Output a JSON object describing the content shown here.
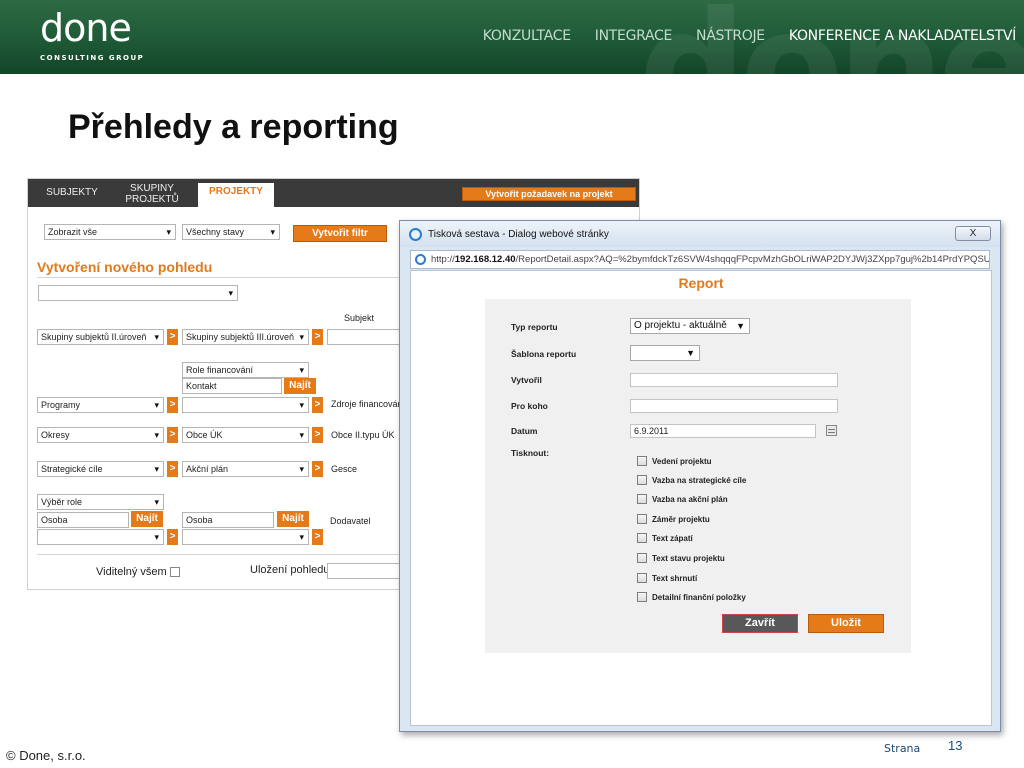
{
  "header": {
    "logo": "done",
    "logo_sub": "CONSULTING GROUP",
    "nav": [
      "KONZULTACE",
      "INTEGRACE",
      "NÁSTROJE",
      "KONFERENCE A NAKLADATELSTVÍ"
    ]
  },
  "slide_title": "Přehledy a reporting",
  "app": {
    "tabs": [
      "SUBJEKTY",
      "SKUPINY PROJEKTŮ",
      "PROJEKTY"
    ],
    "create_request_button": "Vytvořit požadavek na projekt",
    "filter_show": "Zobrazit vše",
    "filter_states": "Všechny stavy",
    "create_filter_button": "Vytvořit filtr",
    "section_title": "Vytvoření nového pohledu",
    "rows": {
      "subjekt": "Subjekt",
      "skupiny2": "Skupiny subjektů II.úroveň",
      "skupiny3": "Skupiny subjektů III.úroveň",
      "role_fin": "Role financování",
      "kontakt": "Kontakt",
      "najit": "Najít",
      "programy": "Programy",
      "zdroje": "Zdroje financován",
      "okresy": "Okresy",
      "obce_uk": "Obce ÚK",
      "obce_ii": "Obce II.typu ÚK",
      "strategicke": "Strategické cíle",
      "akcni": "Akční plán",
      "gesce": "Gesce",
      "vyber_role": "Výběr role",
      "osoba": "Osoba",
      "dodavatel": "Dodavatel"
    },
    "visible_all": "Viditelný všem",
    "save_view": "Uložení pohledu"
  },
  "dialog": {
    "title": "Tisková sestava - Dialog webové stránky",
    "close_label": "X",
    "address_prefix": "http://",
    "address_host": "192.168.12.40",
    "address_path": "/ReportDetail.aspx?AQ=%2bymfdckTz6SVW4shqqqFPcpvMzhGbOLriWAP2DYJWj3ZXpp7guj%2b14PrdYPQSU",
    "report_title": "Report",
    "form": {
      "typ_label": "Typ reportu",
      "typ_value": "O projektu - aktuálně",
      "sablona_label": "Šablona reportu",
      "vytvoril_label": "Vytvořil",
      "pro_koho_label": "Pro koho",
      "datum_label": "Datum",
      "datum_value": "6.9.2011",
      "tisknout_label": "Tisknout:"
    },
    "checkboxes": [
      "Vedení projektu",
      "Vazba na strategické cíle",
      "Vazba na akční plán",
      "Záměr projektu",
      "Text zápatí",
      "Text stavu projektu",
      "Text shrnutí",
      "Detailní finanční položky"
    ],
    "close_button": "Zavřít",
    "save_button": "Uložit"
  },
  "footer": {
    "copyright": "©  Done, s.r.o.",
    "page_label": "Strana",
    "page_number": "13"
  }
}
